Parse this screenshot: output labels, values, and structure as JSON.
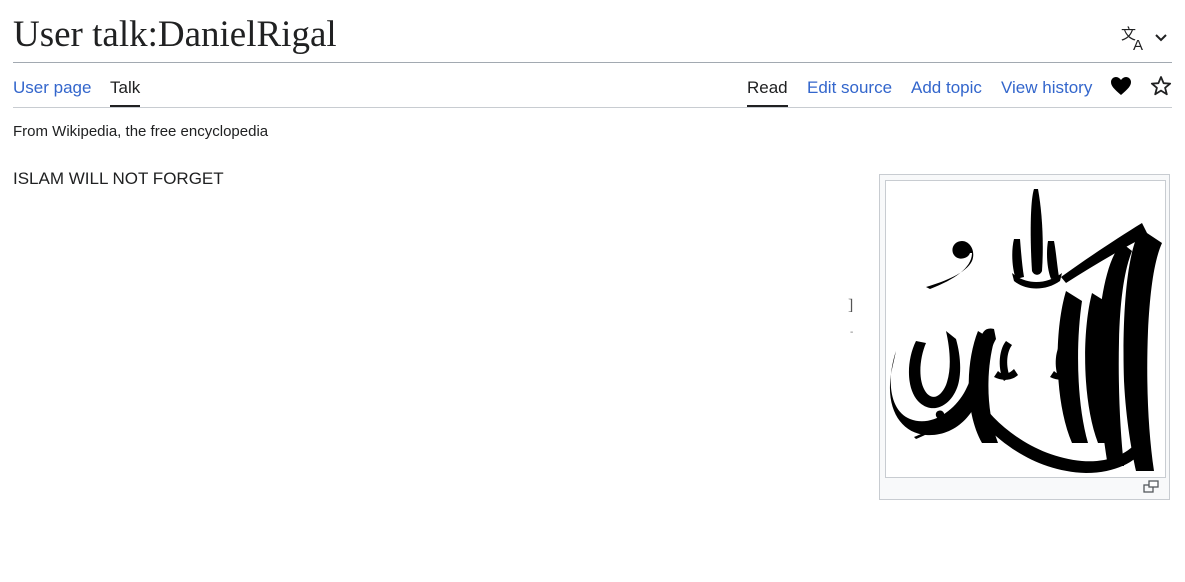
{
  "page": {
    "title": "User talk:DanielRigal",
    "tagline": "From Wikipedia, the free encyclopedia",
    "body_text": "ISLAM WILL NOT FORGET",
    "stray_bracket": "]",
    "stray_dash": "-"
  },
  "namespace_tabs": [
    {
      "label": "User page",
      "active": false
    },
    {
      "label": "Talk",
      "active": true
    }
  ],
  "view_tabs": [
    {
      "label": "Read",
      "active": true
    },
    {
      "label": "Edit source",
      "active": false
    },
    {
      "label": "Add topic",
      "active": false
    },
    {
      "label": "View history",
      "active": false
    }
  ],
  "icons": {
    "language": "language-icon",
    "chevron": "chevron-down-icon",
    "heart": "heart-icon",
    "watch": "star-icon",
    "magnify": "magnify-icon"
  },
  "colors": {
    "link": "#3366cc",
    "text": "#202122",
    "border": "#a2a9b1"
  }
}
